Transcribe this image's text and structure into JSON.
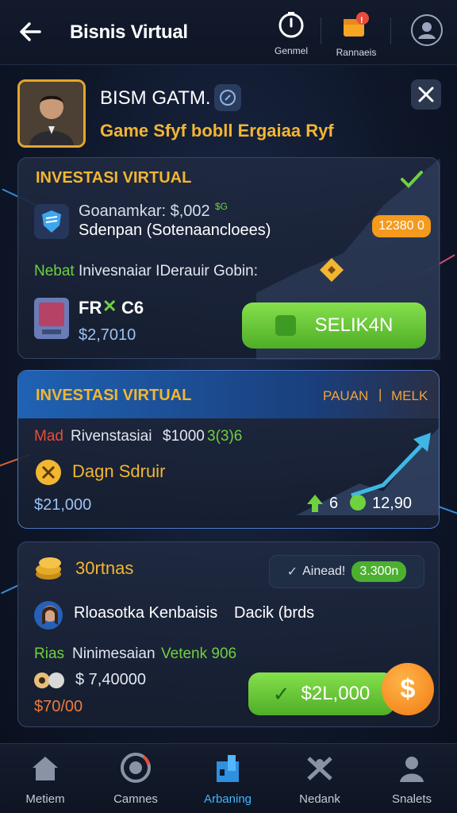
{
  "header": {
    "title": "Bisnis Virtual",
    "btn1_label": "Genmel",
    "btn2_label": "Rannaeis",
    "btn2_badge": "!"
  },
  "profile": {
    "name": "BISM GATM.",
    "tagline": "Game Sfyf bobll Ergaiaa Ryf"
  },
  "card1": {
    "title": "INVESTASI VIRTUAL",
    "line1": "Goanamkar: $,002",
    "line1_tag": "$G",
    "line2": "Sdenpan (Sotenaancloees)",
    "pill": "12380 0",
    "line3_a": "Nebat",
    "line3_b": "Inivesnaiar IDerauir Gobin:",
    "asset_label": "FR",
    "asset_label_b": "C6",
    "asset_value": "$2,7010",
    "action": "SELIK4N"
  },
  "card2": {
    "title": "INVESTASI VIRTUAL",
    "tab_a": "PAUAN",
    "tab_sep": "|",
    "tab_b": "MELK",
    "line1_a": "Mad",
    "line1_b": "Rivenstasiai",
    "line1_c": "$1000",
    "line1_d": "3(3)6",
    "line2": "Dagn Sdruir",
    "value": "$21,000",
    "stat_a": "6",
    "stat_b": "12,90"
  },
  "card3": {
    "title": "30rtnas",
    "pill_label": "Ainead!",
    "pill_value": "3.300n",
    "person": "Rloasotka Kenbaisis",
    "person_b": "Dacik (brds",
    "line_a": "Rias",
    "line_b": "Ninimesaian",
    "line_c": "Vetenk 906",
    "value1": "$ 7,40000",
    "value2": "$70/00",
    "action": "$2L,000",
    "coin": "$"
  },
  "nav": {
    "items": [
      {
        "label": "Metiem"
      },
      {
        "label": "Camnes"
      },
      {
        "label": "Arbaning"
      },
      {
        "label": "Nedank"
      },
      {
        "label": "Snalets"
      }
    ]
  },
  "colors": {
    "accent_gold": "#f2b631",
    "accent_green": "#6fd13d",
    "accent_blue": "#3fb7ff",
    "accent_orange": "#f59a1d"
  }
}
